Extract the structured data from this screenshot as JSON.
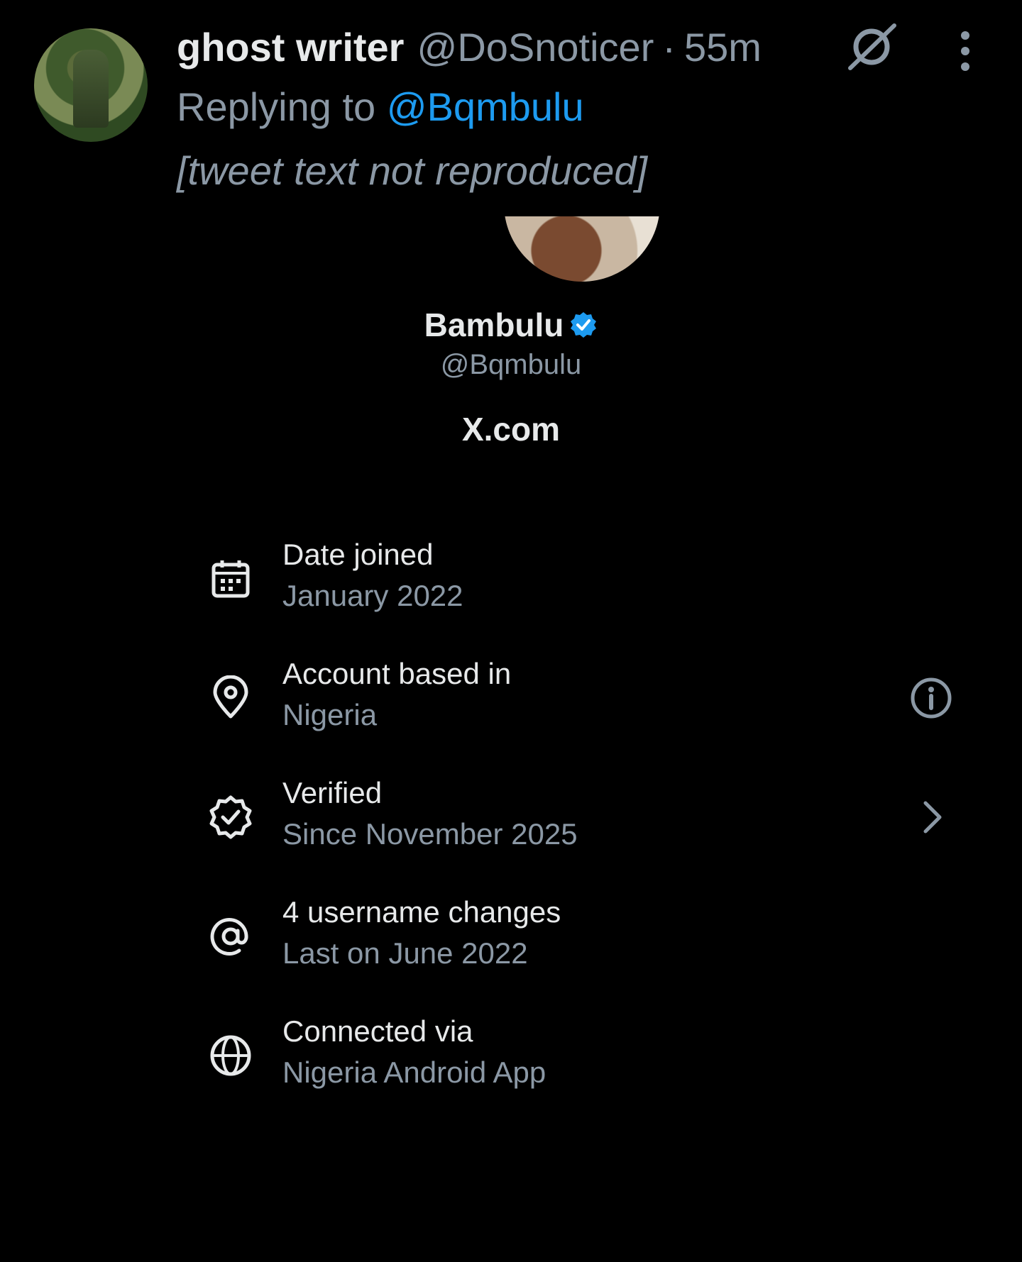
{
  "tweet": {
    "author_name": "ghost writer",
    "author_handle": "@DoSnoticer",
    "separator": "·",
    "time": "55m",
    "replying_prefix": "Replying to ",
    "replying_to": "@Bqmbulu",
    "text": "[tweet text not reproduced]",
    "icons": [
      "grok-icon",
      "more-vertical-icon"
    ]
  },
  "profile": {
    "name": "Bambulu",
    "handle": "@Bqmbulu",
    "site": "X.com",
    "verified_color": "#1d9bf0"
  },
  "info_rows": [
    {
      "icon": "calendar-icon",
      "title": "Date joined",
      "subtitle": "January 2022"
    },
    {
      "icon": "location-pin-icon",
      "title": "Account based in",
      "subtitle": "Nigeria",
      "action": "info-icon"
    },
    {
      "icon": "verified-check-icon",
      "title": "Verified",
      "subtitle": "Since November 2025",
      "action": "chevron-right-icon"
    },
    {
      "icon": "at-sign-icon",
      "title": "4 username changes",
      "subtitle": "Last on June 2022"
    },
    {
      "icon": "globe-icon",
      "title": "Connected via",
      "subtitle": "Nigeria Android App"
    }
  ],
  "colors": {
    "background": "#000000",
    "primary_text": "#e7e9ea",
    "secondary_text": "#8b98a5",
    "accent": "#1d9bf0"
  }
}
